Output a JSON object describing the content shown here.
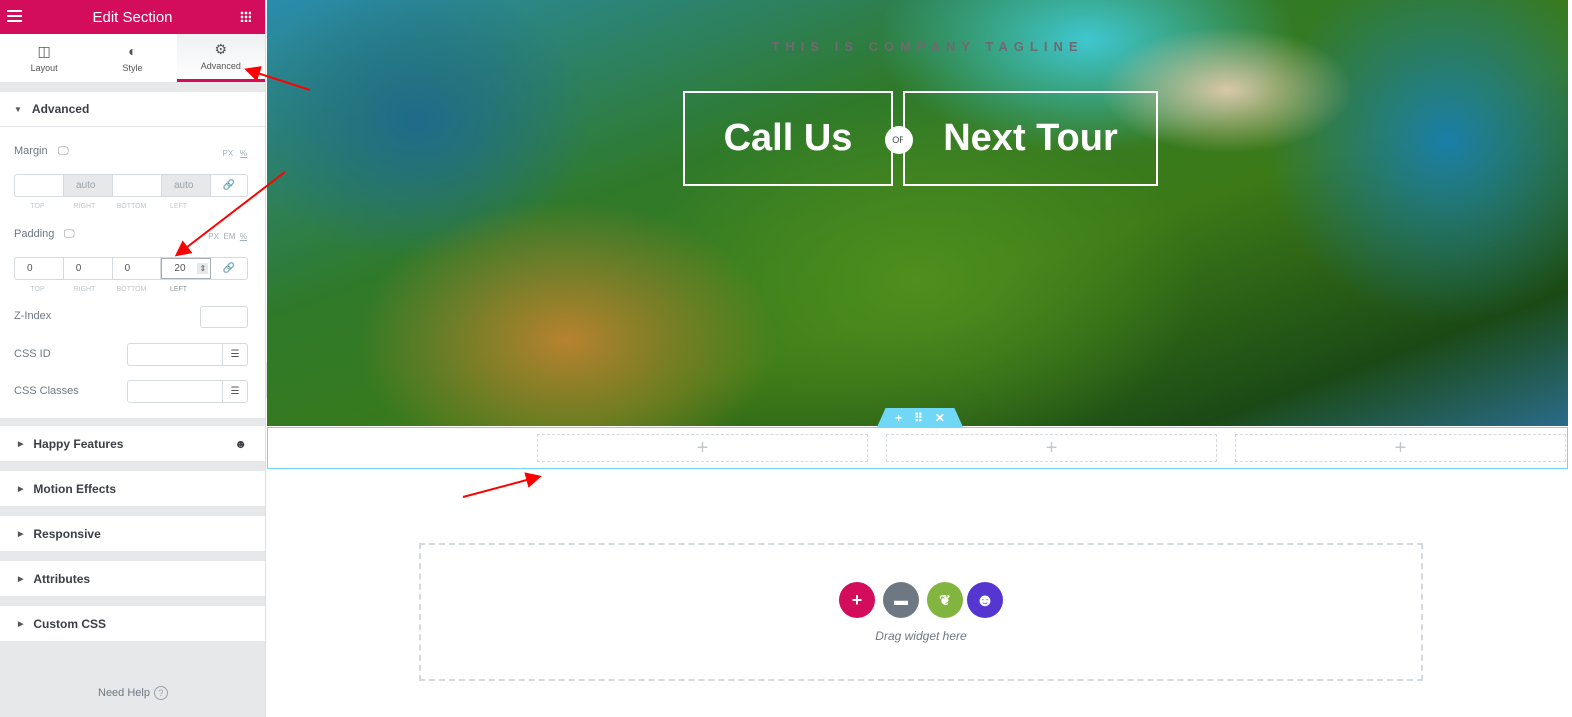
{
  "header": {
    "title": "Edit Section"
  },
  "tabs": [
    {
      "label": "Layout",
      "icon": "columns-icon"
    },
    {
      "label": "Style",
      "icon": "contrast-icon"
    },
    {
      "label": "Advanced",
      "icon": "gear-icon",
      "active": true
    }
  ],
  "advanced": {
    "title": "Advanced",
    "margin": {
      "label": "Margin",
      "units": [
        "PX",
        "%"
      ],
      "values": {
        "top": "",
        "right": "auto",
        "bottom": "",
        "left": "auto"
      },
      "sublabels": [
        "TOP",
        "RIGHT",
        "BOTTOM",
        "LEFT"
      ]
    },
    "padding": {
      "label": "Padding",
      "units": [
        "PX",
        "EM",
        "%"
      ],
      "values": {
        "top": "0",
        "right": "0",
        "bottom": "0",
        "left": "20"
      },
      "sublabels": [
        "TOP",
        "RIGHT",
        "BOTTOM",
        "LEFT"
      ]
    },
    "z_index": {
      "label": "Z-Index",
      "value": ""
    },
    "css_id": {
      "label": "CSS ID",
      "value": ""
    },
    "css_classes": {
      "label": "CSS Classes",
      "value": ""
    }
  },
  "collapsed_sections": [
    "Happy Features",
    "Motion Effects",
    "Responsive",
    "Attributes",
    "Custom CSS"
  ],
  "need_help": "Need Help",
  "hero": {
    "tagline": "THIS IS COMPANY TAGLINE",
    "cta_left": "Call Us",
    "or": "OR",
    "cta_right": "Next Tour"
  },
  "drop_zone": {
    "text": "Drag widget here"
  },
  "colors": {
    "accent": "#d30c5c",
    "section_handle": "#71d7f7",
    "folder": "#6d7882",
    "envato": "#82b440",
    "happy": "#5636d1"
  }
}
